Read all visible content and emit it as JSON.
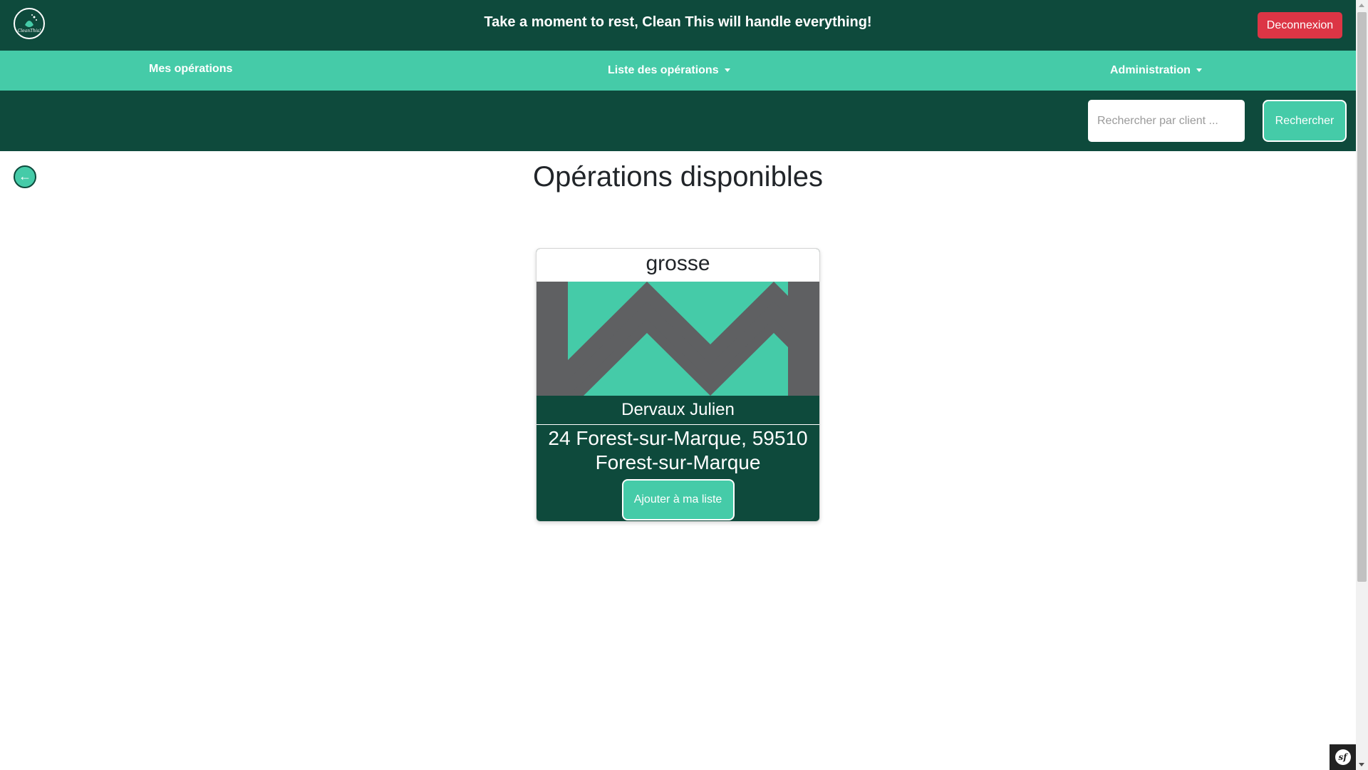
{
  "header": {
    "logo_text": "CleanThis!",
    "tagline": "Take a moment to rest, Clean This will handle everything!",
    "logout_label": "Deconnexion"
  },
  "nav": {
    "items": [
      {
        "label": "Mes opérations",
        "has_dropdown": false
      },
      {
        "label": "Liste des opérations",
        "has_dropdown": true
      },
      {
        "label": "Administration",
        "has_dropdown": true
      }
    ]
  },
  "search": {
    "placeholder": "Rechercher par client ...",
    "value": "",
    "button_label": "Rechercher"
  },
  "main": {
    "back_icon": "←",
    "title": "Opérations disponibles",
    "cards": [
      {
        "type": "grosse",
        "image_icon": "zigzag-placeholder-image",
        "client": "Dervaux Julien",
        "address": "24 Forest-sur-Marque, 59510 Forest-sur-Marque",
        "button_label": "Ajouter à ma liste"
      }
    ]
  },
  "toolbar": {
    "badge_text": "sf"
  },
  "colors": {
    "dark_green": "#0e4a3c",
    "accent_green": "#45cba8",
    "logout_red": "#dc3545",
    "placeholder_gray": "#5f6062"
  }
}
